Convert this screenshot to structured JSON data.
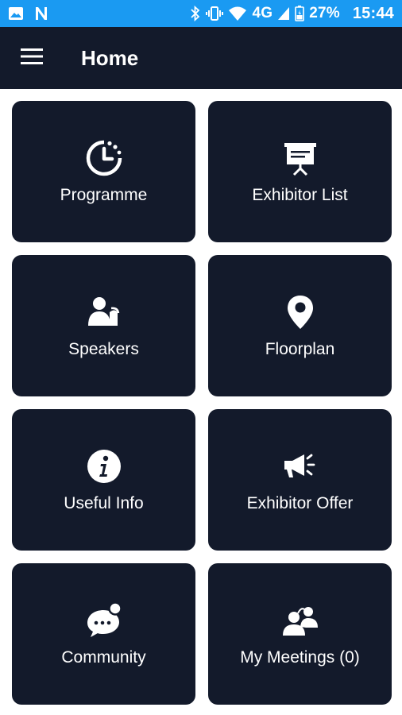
{
  "status_bar": {
    "network": "4G",
    "battery": "27%",
    "time": "15:44"
  },
  "header": {
    "title": "Home"
  },
  "tiles": [
    {
      "label": "Programme",
      "icon": "clock-icon"
    },
    {
      "label": "Exhibitor List",
      "icon": "presentation-board-icon"
    },
    {
      "label": "Speakers",
      "icon": "speaker-person-icon"
    },
    {
      "label": "Floorplan",
      "icon": "map-pin-icon"
    },
    {
      "label": "Useful Info",
      "icon": "info-icon"
    },
    {
      "label": "Exhibitor Offer",
      "icon": "megaphone-icon"
    },
    {
      "label": "Community",
      "icon": "chat-bubble-icon"
    },
    {
      "label": "My Meetings (0)",
      "icon": "people-icon"
    }
  ],
  "colors": {
    "status_bar": "#1a9af2",
    "app_bar": "#131a2b",
    "tile": "#131a2b",
    "background": "#ffffff",
    "text": "#ffffff"
  }
}
